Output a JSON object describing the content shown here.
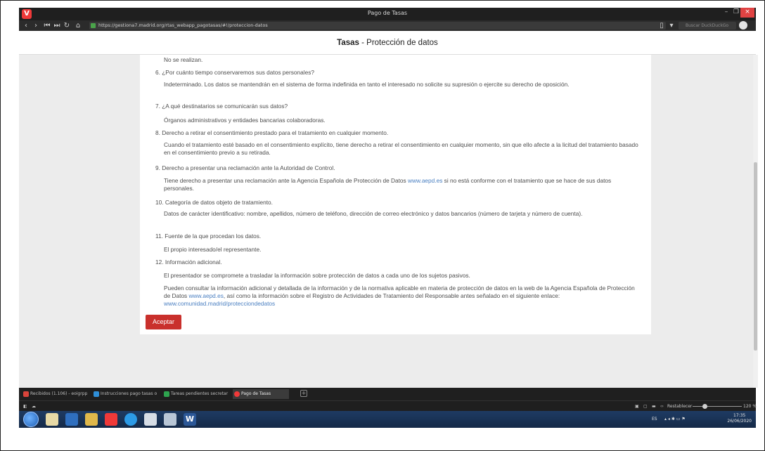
{
  "window": {
    "title": "Pago de Tasas"
  },
  "navbar": {
    "url": "https://gestiona7.madrid.org/rtas_webapp_pagotasas/#!/proteccion-datos",
    "search_placeholder": "Buscar DuckDuckGo"
  },
  "page": {
    "title_bold": "Tasas",
    "title_rest": " - Protección de datos",
    "prev_answer": "No se realizan.",
    "items": [
      {
        "q": "6. ¿Por cuánto tiempo conservaremos sus datos personales?",
        "a": "Indeterminado. Los datos se mantendrán en el sistema de forma indefinida en tanto el interesado no solicite su supresión o ejercite su derecho de oposición."
      },
      {
        "q": "7. ¿A qué destinatarios se comunicarán sus datos?",
        "a": "Órganos administrativos y entidades bancarias colaboradoras."
      },
      {
        "q": "8. Derecho a retirar el consentimiento prestado para el tratamiento en cualquier momento.",
        "a": "Cuando el tratamiento esté basado en el consentimiento explícito, tiene derecho a retirar el consentimiento en cualquier momento, sin que ello afecte a la licitud del tratamiento basado en el consentimiento previo a su retirada."
      },
      {
        "q": "9. Derecho a presentar una reclamación ante la Autoridad de Control.",
        "a_pre": "Tiene derecho a presentar una reclamación ante la Agencia Española de Protección de Datos ",
        "a_link": "www.aepd.es",
        "a_post": " si no está conforme con el tratamiento que se hace de sus datos personales."
      },
      {
        "q": "10. Categoría de datos objeto de tratamiento.",
        "a": "Datos de carácter identificativo: nombre, apellidos, número de teléfono, dirección de correo electrónico y datos bancarios (número de tarjeta y número de cuenta)."
      },
      {
        "q": "11. Fuente de la que procedan los datos.",
        "a": "El propio interesado/el representante."
      },
      {
        "q": "12. Información adicional.",
        "a": "El presentador se compromete a trasladar la información sobre protección de datos a cada uno de los sujetos pasivos.",
        "a2_pre": "Pueden consultar la información adicional y detallada de la información y de la normativa aplicable en materia de protección de datos en la web de la Agencia Española de Protección de Datos ",
        "a2_link1": "www.aepd.es",
        "a2_mid": ", así como la información sobre el Registro de Actividades de Tratamiento del Responsable antes señalado en el siguiente enlace: ",
        "a2_link2": "www.comunidad.madrid/protecciondedatos"
      }
    ],
    "accept_label": "Aceptar"
  },
  "tabs": [
    {
      "label": "Recibidos (1.106) - eoigrpp",
      "color": "#d9443b"
    },
    {
      "label": "Instrucciones pago tasas o",
      "color": "#2f8fd8"
    },
    {
      "label": "Tareas pendientes secretar",
      "color": "#2ea44f"
    },
    {
      "label": "Pago de Tasas",
      "color": "#ef3939",
      "active": true
    }
  ],
  "statusbar": {
    "reset_label": "Restablecer",
    "zoom": "120 %"
  },
  "taskbar": {
    "lang": "ES",
    "time": "17:35",
    "date": "26/06/2020"
  }
}
